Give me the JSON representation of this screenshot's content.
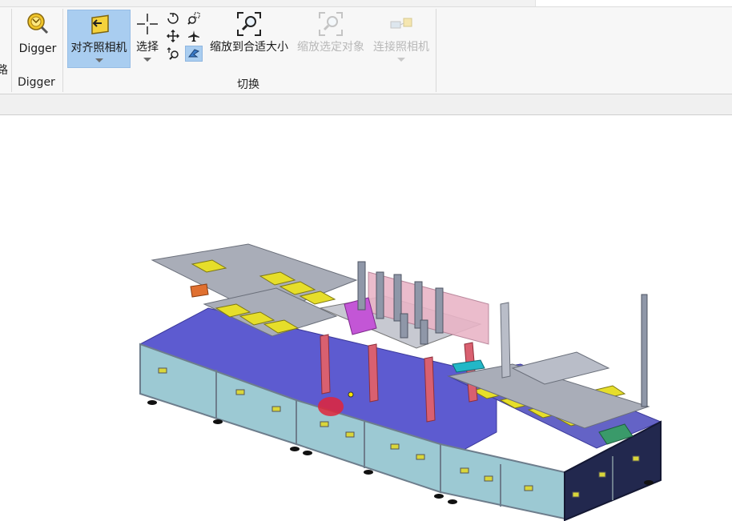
{
  "ribbon": {
    "cut_label": "路",
    "digger_group": {
      "button_label": "Digger",
      "group_label": "Digger"
    },
    "switch_group": {
      "group_label": "切换",
      "align_camera_label": "对齐照相机",
      "select_label": "选择",
      "zoom_fit_label": "缩放到合适大小",
      "zoom_selected_label": "缩放选定对象",
      "connect_camera_label": "连接照相机"
    },
    "small_tools": [
      "rotate-icon",
      "zoom-window-icon",
      "pan-icon",
      "fly-icon",
      "zoom-icon",
      "walk-icon"
    ]
  },
  "viewport": {
    "scene": "3d-machine-assembly",
    "colors": {
      "frame": "#8c96a8",
      "cabinet": "#9cc9d3",
      "deck": "#5d5bd0",
      "yellow_parts": "#e6de2a",
      "red_posts": "#d96070",
      "pink_panel": "#e9b5c7",
      "magenta": "#c356d6",
      "dark_cabinet": "#22284e"
    }
  }
}
